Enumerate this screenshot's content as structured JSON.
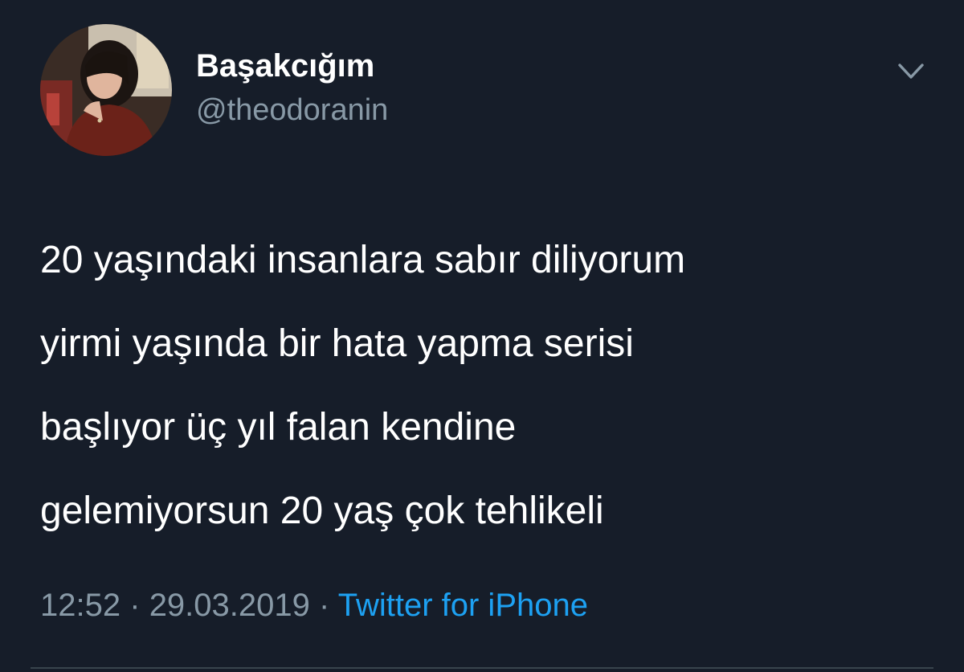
{
  "tweet": {
    "author": {
      "display_name": "Başakcığım",
      "handle": "@theodoranin",
      "avatar_icon": "user-photo"
    },
    "menu_icon": "chevron-down-icon",
    "text_lines": [
      "20 yaşındaki insanlara sabır diliyorum",
      "yirmi yaşında bir hata yapma serisi",
      "başlıyor üç yıl falan kendine",
      "gelemiyorsun 20 yaş çok tehlikeli"
    ],
    "time": "12:52",
    "separator": "·",
    "date": "29.03.2019",
    "source": "Twitter for iPhone"
  },
  "colors": {
    "background": "#161d29",
    "text": "#ffffff",
    "secondary": "#8899a6",
    "accent": "#1da1f2"
  }
}
